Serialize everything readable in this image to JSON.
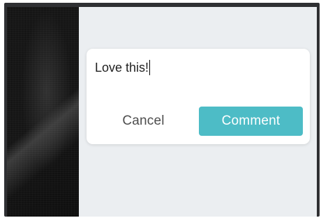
{
  "comment_box": {
    "input_value": "Love this!",
    "cancel_label": "Cancel",
    "submit_label": "Comment"
  },
  "colors": {
    "accent": "#4dbcc6",
    "panel_background": "#ebeef1",
    "frame": "#2f3033"
  }
}
